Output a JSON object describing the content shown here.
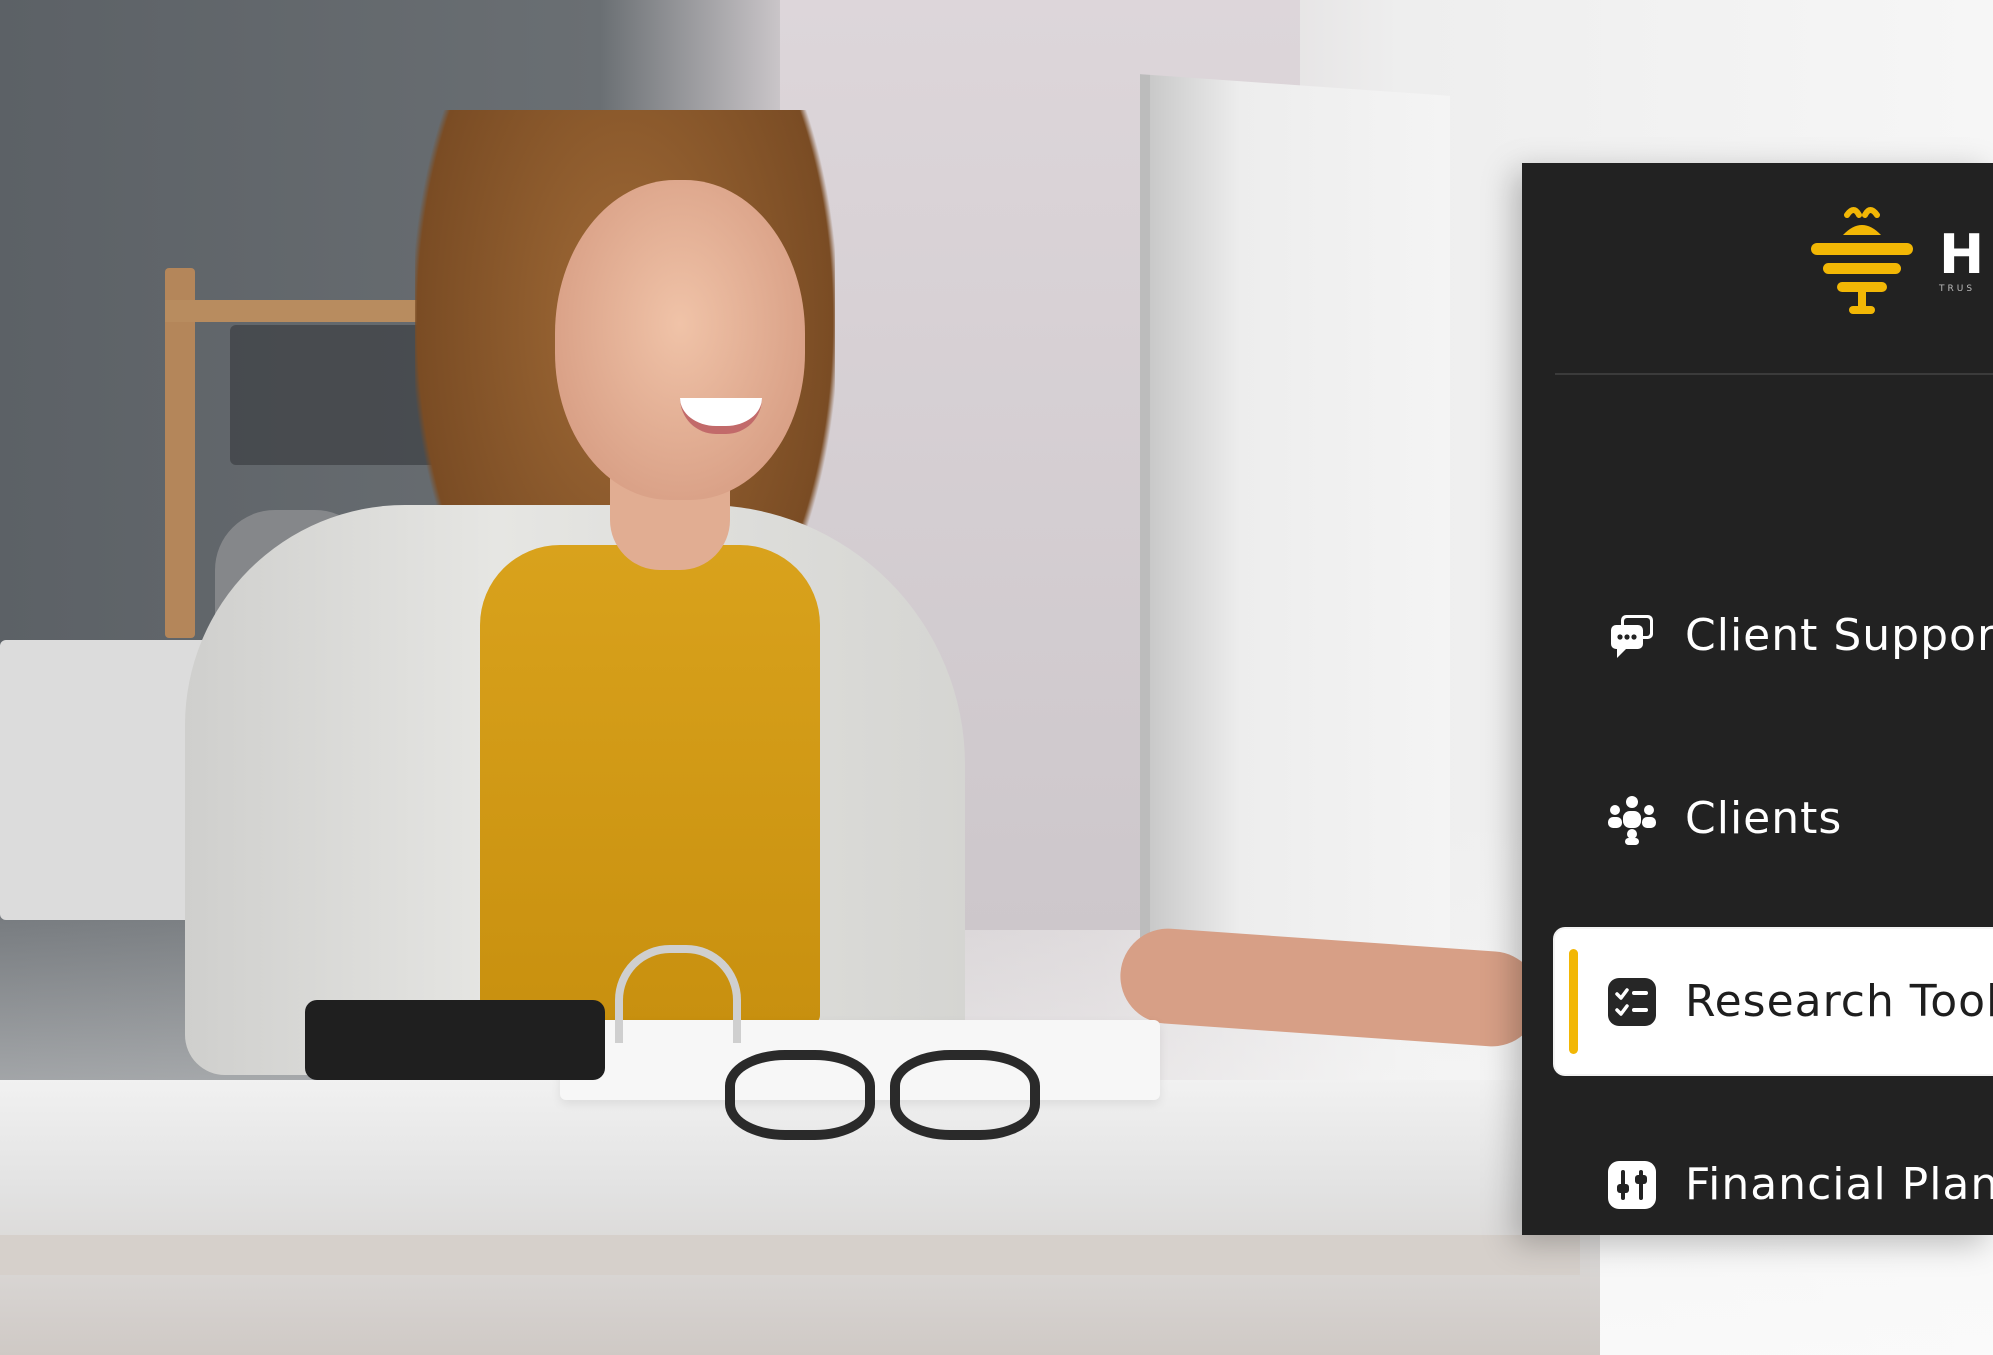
{
  "brand": {
    "name": "H",
    "tagline": "TRUS",
    "logo_icon": "bee-logo-icon",
    "accent_color": "#f2b705"
  },
  "sidebar": {
    "background_color": "#222222",
    "items": [
      {
        "label": "Client Support",
        "icon": "chat-bubbles-icon",
        "active": false
      },
      {
        "label": "Clients",
        "icon": "users-group-icon",
        "active": false
      },
      {
        "label": "Research Tools",
        "icon": "checklist-icon",
        "active": true
      },
      {
        "label": "Financial Planning",
        "icon": "sliders-icon",
        "active": false
      }
    ]
  }
}
